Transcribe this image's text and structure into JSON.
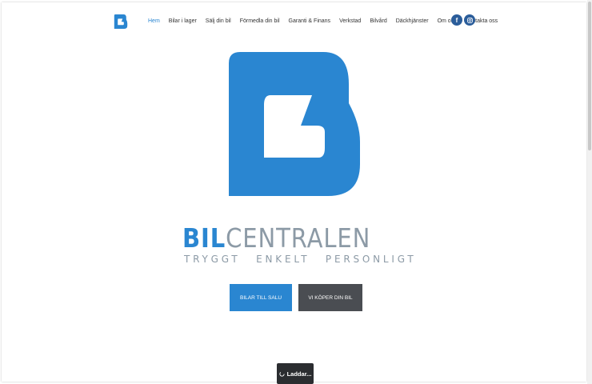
{
  "nav": {
    "items": [
      "Hem",
      "Bilar i lager",
      "Sälj din bil",
      "Förmedla din bil",
      "Garanti & Finans",
      "Verkstad",
      "Bilvård",
      "Däckhjänster",
      "Om oss",
      "Kontakta oss"
    ],
    "active_index": 0
  },
  "social": {
    "facebook": "f",
    "instagram": "instagram-icon"
  },
  "brand": {
    "wordmark_part1": "BIL",
    "wordmark_part2": "CENTRALEN",
    "tagline": "TRYGGT ENKELT PERSONLIGT",
    "logo_icon": "bilcentralen-b-logo"
  },
  "buttons": {
    "primary": "BILAR TILL SALU",
    "secondary": "VI KÖPER DIN BIL"
  },
  "loading": {
    "label": "Laddar..."
  },
  "colors": {
    "brand_blue": "#2a86d1",
    "gray_text": "#8c9aa6",
    "dark_button": "#4a4d52",
    "social": "#2b5d9a"
  }
}
